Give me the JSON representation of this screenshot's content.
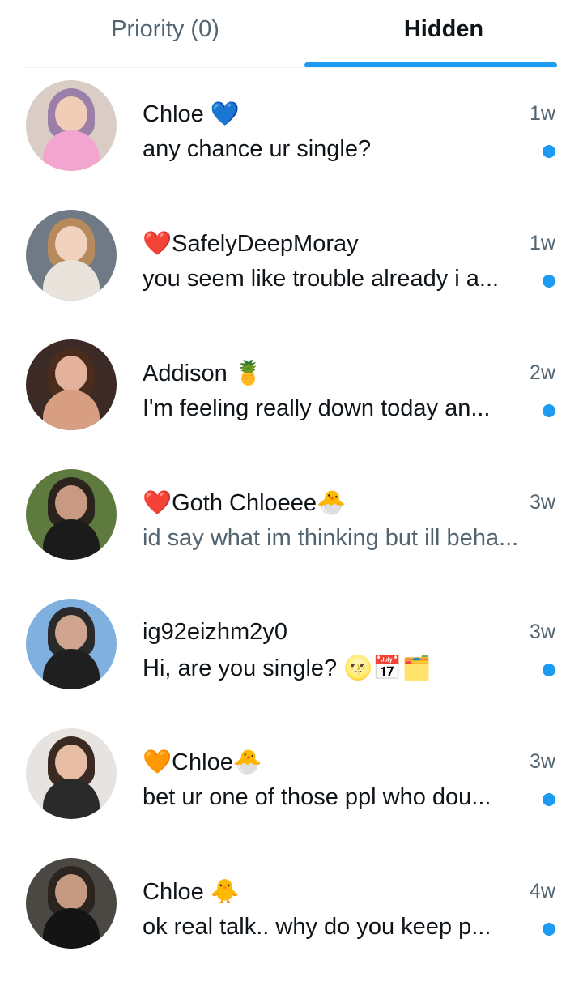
{
  "tabs": {
    "priority_label": "Priority (0)",
    "hidden_label": "Hidden",
    "active": "Hidden"
  },
  "colors": {
    "accent": "#1d9bf0",
    "muted": "#536471",
    "text": "#0f1419"
  },
  "messages": [
    {
      "name": "Chloe 💙",
      "time": "1w",
      "preview": "any chance ur single?",
      "unread": true
    },
    {
      "name": "❤️SafelyDeepMoray",
      "time": "1w",
      "preview": "you seem like trouble already i a...",
      "unread": true
    },
    {
      "name": "Addison 🍍",
      "time": "2w",
      "preview": "I'm feeling really down today an...",
      "unread": true
    },
    {
      "name": "❤️Goth Chloeee🐣",
      "time": "3w",
      "preview": "id say what im thinking but ill beha...",
      "unread": false
    },
    {
      "name": "ig92eizhm2y0",
      "time": "3w",
      "preview": "Hi, are you single? 🌝📅🗂️",
      "unread": true
    },
    {
      "name": "🧡Chloe🐣",
      "time": "3w",
      "preview": "bet ur one of those ppl who dou...",
      "unread": true
    },
    {
      "name": "Chloe 🐥",
      "time": "4w",
      "preview": "ok real talk.. why do you keep p...",
      "unread": true
    }
  ]
}
